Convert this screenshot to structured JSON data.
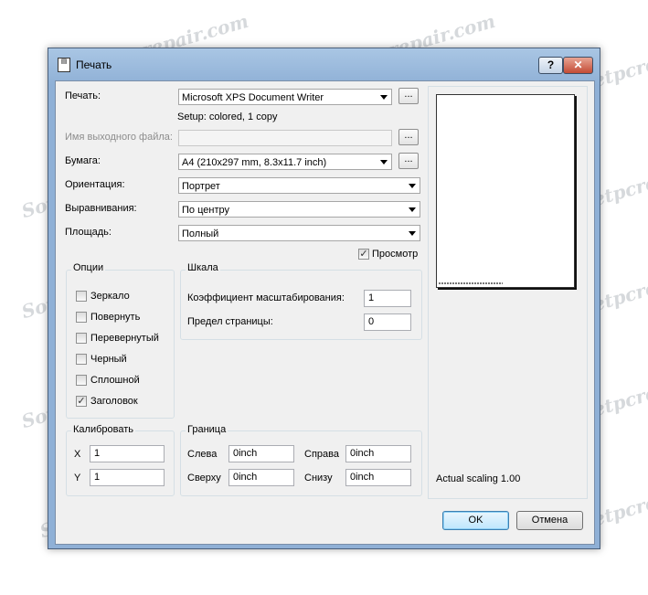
{
  "watermark": "Sovietpcrepair.com",
  "window": {
    "title": "Печать",
    "help_label": "?",
    "close_label": "✕"
  },
  "printer": {
    "label": "Печать:",
    "value": "Microsoft XPS Document Writer",
    "setup": "Setup: colored, 1 copy"
  },
  "output_file": {
    "label": "Имя выходного файла:",
    "value": ""
  },
  "paper": {
    "label": "Бумага:",
    "value": "A4 (210x297 mm, 8.3x11.7 inch)"
  },
  "orientation": {
    "label": "Ориентация:",
    "value": "Портрет"
  },
  "alignment": {
    "label": "Выравнивания:",
    "value": "По центру"
  },
  "area": {
    "label": "Площадь:",
    "value": "Полный"
  },
  "browse_label": "...",
  "preview": {
    "label": "Просмотр",
    "checked": true,
    "scaling": "Actual scaling 1.00"
  },
  "options": {
    "title": "Опции",
    "items": [
      {
        "label": "Зеркало",
        "checked": false
      },
      {
        "label": "Повернуть",
        "checked": false
      },
      {
        "label": "Перевернутый",
        "checked": false
      },
      {
        "label": "Черный",
        "checked": false
      },
      {
        "label": "Сплошной",
        "checked": false
      },
      {
        "label": "Заголовок",
        "checked": true
      }
    ]
  },
  "scale": {
    "title": "Шкала",
    "factor_label": "Коэффициент масштабирования:",
    "factor_value": "1",
    "limit_label": "Предел страницы:",
    "limit_value": "0"
  },
  "calibrate": {
    "title": "Калибровать",
    "x_label": "X",
    "x_value": "1",
    "y_label": "Y",
    "y_value": "1"
  },
  "margins": {
    "title": "Граница",
    "left_label": "Слева",
    "left_value": "0inch",
    "right_label": "Справа",
    "right_value": "0inch",
    "top_label": "Сверху",
    "top_value": "0inch",
    "bottom_label": "Снизу",
    "bottom_value": "0inch"
  },
  "buttons": {
    "ok": "OK",
    "cancel": "Отмена"
  }
}
